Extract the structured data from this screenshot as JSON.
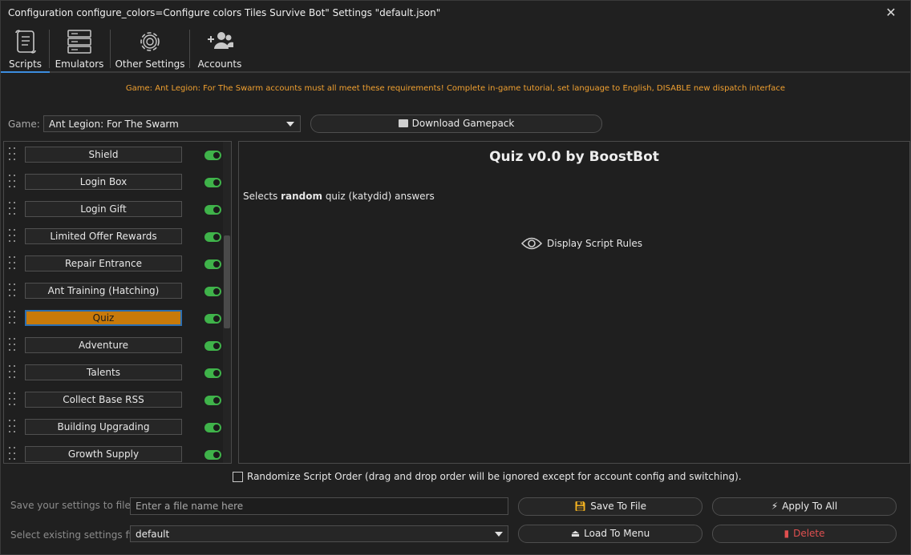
{
  "window": {
    "title": "Configuration configure_colors=Configure colors Tiles Survive Bot\" Settings \"default.json\"",
    "close_glyph": "✕"
  },
  "tabs": [
    {
      "label": "Scripts",
      "icon": "scroll-icon",
      "active": true
    },
    {
      "label": "Emulators",
      "icon": "server-icon",
      "active": false
    },
    {
      "label": "Other Settings",
      "icon": "gear-icon",
      "active": false
    },
    {
      "label": "Accounts",
      "icon": "add-user-icon",
      "active": false
    }
  ],
  "notice": "Game: Ant Legion: For The Swarm accounts must all meet these requirements! Complete in-game tutorial, set language to English, DISABLE new dispatch interface",
  "game": {
    "label": "Game:",
    "selected": "Ant Legion: For The Swarm",
    "download_label": "Download Gamepack"
  },
  "scripts": [
    {
      "name": "Shield",
      "enabled": true
    },
    {
      "name": "Login Box",
      "enabled": true
    },
    {
      "name": "Login Gift",
      "enabled": true
    },
    {
      "name": "Limited Offer Rewards",
      "enabled": true
    },
    {
      "name": "Repair Entrance",
      "enabled": true
    },
    {
      "name": "Ant Training (Hatching)",
      "enabled": true
    },
    {
      "name": "Quiz",
      "enabled": true,
      "selected": true
    },
    {
      "name": "Adventure",
      "enabled": true
    },
    {
      "name": "Talents",
      "enabled": true
    },
    {
      "name": "Collect Base RSS",
      "enabled": true
    },
    {
      "name": "Building Upgrading",
      "enabled": true
    },
    {
      "name": "Growth Supply",
      "enabled": true
    }
  ],
  "detail": {
    "title": "Quiz v0.0 by BoostBot",
    "desc_prefix": "Selects ",
    "desc_bold": "random",
    "desc_suffix": " quiz (katydid) answers",
    "rules_label": "Display Script Rules"
  },
  "randomize": {
    "label": "Randomize Script Order (drag and drop order will be ignored except for account config and switching).",
    "checked": false
  },
  "save": {
    "label": "Save your settings to file",
    "placeholder": "Enter a file name here",
    "save_button": "Save To File",
    "apply_button": "Apply To All"
  },
  "load": {
    "label": "Select existing settings file",
    "selected": "default",
    "load_button": "Load To Menu",
    "delete_button": "Delete"
  },
  "colors": {
    "accent": "#3c8ddf",
    "selected_script": "#c87a0a",
    "toggle_on": "#3fb34a",
    "notice": "#f0a030",
    "delete": "#e05050"
  }
}
